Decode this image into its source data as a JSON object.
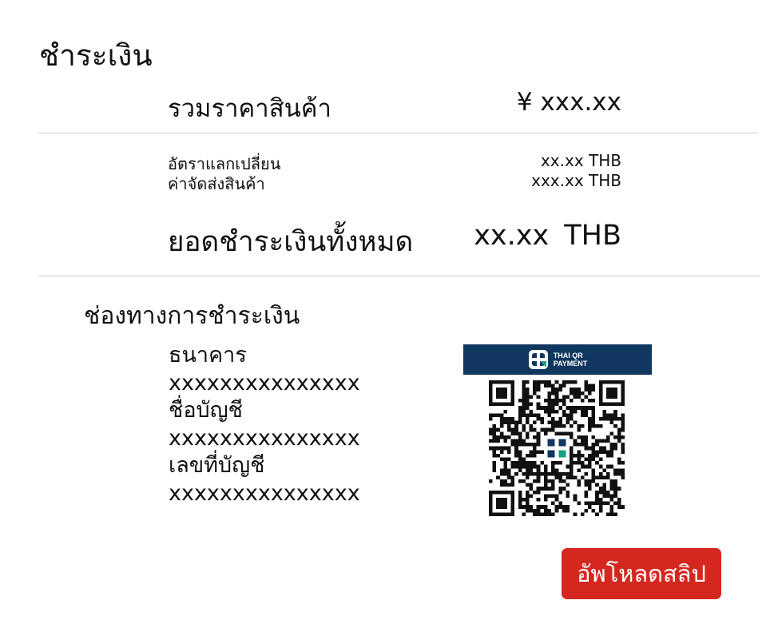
{
  "payment": {
    "title": "ชำระเงิน",
    "subtotal_label": "รวมราคาสินค้า",
    "subtotal_value": "¥ xxx.xx",
    "exchange_rate_label": "อัตราแลกเปลี่ยน",
    "exchange_rate_value": "xx.xx THB",
    "shipping_label": "ค่าจัดส่งสินค้า",
    "shipping_value": "xxx.xx THB",
    "total_label": "ยอดชำระเงินทั้งหมด",
    "total_value": "xx.xx  THB"
  },
  "channels": {
    "title": "ช่องทางการชำระเงิน",
    "bank_label": "ธนาคาร",
    "bank_value": "xxxxxxxxxxxxxxx",
    "account_name_label": "ชื่อบัญชี",
    "account_name_value": "xxxxxxxxxxxxxxx",
    "account_number_label": "เลขที่บัญชี",
    "account_number_value": "xxxxxxxxxxxxxxx"
  },
  "qr": {
    "banner_line1": "THAI QR",
    "banner_line2": "PAYMENT",
    "banner_color": "#10375f",
    "icon": "qr-code-icon"
  },
  "actions": {
    "upload_label": "อัพโหลดสลิป",
    "upload_color": "#d5271f"
  }
}
